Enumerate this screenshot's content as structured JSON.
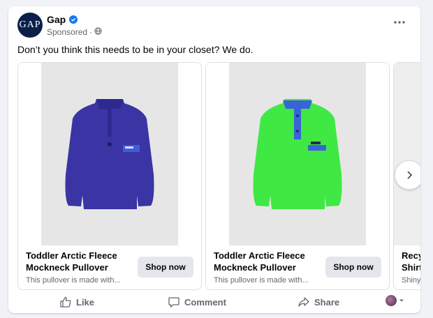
{
  "post": {
    "page_name": "Gap",
    "logo_text": "GAP",
    "sponsored_label": "Sponsored",
    "dot": "·",
    "text": "Don’t you think this needs to be in your closet? We do."
  },
  "products": [
    {
      "title": "Toddler Arctic Fleece Mockneck Pullover",
      "description": "This pullover is made with...",
      "cta": "Shop now",
      "color": "#3b34a5"
    },
    {
      "title": "Toddler Arctic Fleece Mockneck Pullover",
      "description": "This pullover is made with...",
      "cta": "Shop now",
      "color": "#3fe843"
    },
    {
      "title": "Recy Shirt",
      "description": "Shiny",
      "cta": ""
    }
  ],
  "actions": {
    "like": "Like",
    "comment": "Comment",
    "share": "Share"
  },
  "icons": {
    "verified": "verified-badge-icon",
    "globe": "globe-icon",
    "more": "more-options-icon",
    "next": "chevron-right-icon",
    "like": "thumbs-up-icon",
    "comment": "comment-bubble-icon",
    "share": "share-arrow-icon"
  }
}
